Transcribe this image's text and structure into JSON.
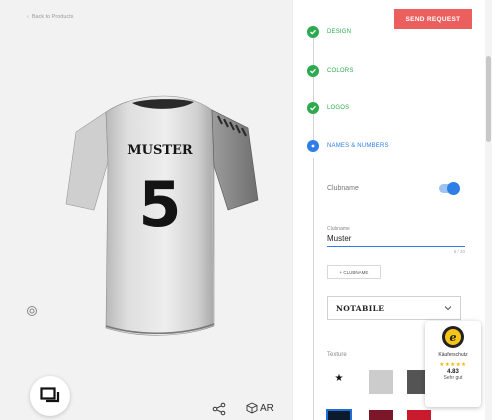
{
  "viewer": {
    "back_label": "Back to Products",
    "jersey_name": "MUSTER",
    "jersey_number": "5",
    "ar_label": "AR"
  },
  "panel": {
    "send_request_label": "SEND REQUEST",
    "steps": [
      {
        "label": "DESIGN",
        "state": "done"
      },
      {
        "label": "COLORS",
        "state": "done"
      },
      {
        "label": "LOGOS",
        "state": "done"
      },
      {
        "label": "NAMES & NUMBERS",
        "state": "active"
      }
    ],
    "club_name_toggle_label": "Clubname",
    "club_name_field": {
      "label": "Clubname",
      "value": "Muster",
      "counter": "6 / 20"
    },
    "add_button_label": "+ CLUBNAME",
    "font_select_value": "NOTABILE",
    "texture_label": "Texture",
    "colors": {
      "accent_blue": "#2f7ee6",
      "done_green": "#2eaa4e",
      "send_red": "#ec5f5f",
      "swatch_navy": "#0b1a2c",
      "swatch_maroon": "#7b1729",
      "swatch_red": "#ca1a2e"
    }
  },
  "trust_badge": {
    "label": "Käuferschutz",
    "stars": "★★★★★",
    "score": "4.83",
    "rating_text": "Sehr gut"
  }
}
